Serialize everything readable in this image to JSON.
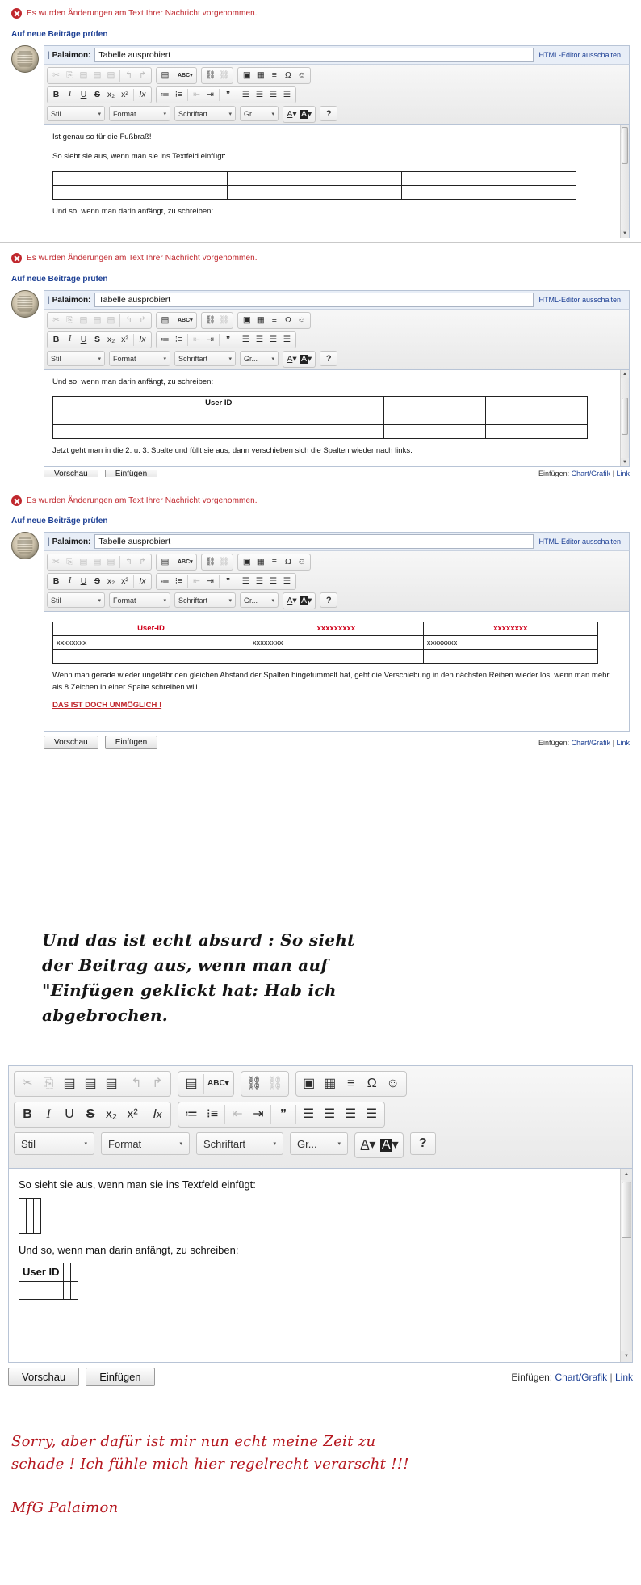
{
  "alert": {
    "text": "Es wurden Änderungen am Text Ihrer Nachricht vorgenommen.",
    "icon": "error-circle-icon",
    "color": "#c0272d"
  },
  "check_posts_link": "Auf neue Beiträge prüfen",
  "subject": {
    "author_prefix": "|",
    "author": "Palaimon:",
    "value": "Tabelle ausprobiert",
    "html_editor_toggle": "HTML-Editor ausschalten"
  },
  "toolbar": {
    "row1": [
      {
        "name": "cut-icon",
        "glyph": "✂",
        "dim": true
      },
      {
        "name": "copy-icon",
        "glyph": "⎘",
        "dim": true
      },
      {
        "name": "paste-icon",
        "glyph": "📋",
        "dim": true
      },
      {
        "name": "paste-as-text-icon",
        "glyph": "📋",
        "dim": true
      },
      {
        "name": "paste-from-word-icon",
        "glyph": "📋",
        "dim": true
      },
      {
        "name": "undo-icon",
        "glyph": "↰",
        "dim": true
      },
      {
        "name": "redo-icon",
        "glyph": "↱",
        "dim": true
      }
    ],
    "row1b": [
      {
        "name": "blockquote-format-icon",
        "glyph": "▤"
      },
      {
        "name": "spellcheck-icon",
        "glyph": "ABC"
      }
    ],
    "row1c": [
      {
        "name": "link-icon",
        "glyph": "🔗"
      },
      {
        "name": "unlink-icon",
        "glyph": "🔗",
        "dim": true
      }
    ],
    "row1d": [
      {
        "name": "image-icon",
        "glyph": "🖼"
      },
      {
        "name": "table-icon",
        "glyph": "▦"
      },
      {
        "name": "horizontal-rule-icon",
        "glyph": "≡"
      },
      {
        "name": "special-character-icon",
        "glyph": "Ω"
      },
      {
        "name": "smiley-icon",
        "glyph": "☺"
      }
    ],
    "row2": [
      {
        "name": "bold-icon",
        "glyph": "B"
      },
      {
        "name": "italic-icon",
        "glyph": "I"
      },
      {
        "name": "underline-icon",
        "glyph": "U"
      },
      {
        "name": "strikethrough-icon",
        "glyph": "S"
      },
      {
        "name": "subscript-icon",
        "glyph": "x₂"
      },
      {
        "name": "superscript-icon",
        "glyph": "x²"
      },
      {
        "name": "remove-format-icon",
        "glyph": "Ix"
      }
    ],
    "row2b": [
      {
        "name": "numbered-list-icon",
        "glyph": "⒈≡"
      },
      {
        "name": "bulleted-list-icon",
        "glyph": "⁞≡"
      },
      {
        "name": "outdent-icon",
        "glyph": "⇤",
        "dim": true
      },
      {
        "name": "indent-icon",
        "glyph": "⇥"
      },
      {
        "name": "blockquote-icon",
        "glyph": "❞"
      },
      {
        "name": "align-left-icon",
        "glyph": "☰"
      },
      {
        "name": "align-center-icon",
        "glyph": "☰"
      },
      {
        "name": "align-right-icon",
        "glyph": "☰"
      },
      {
        "name": "align-justify-icon",
        "glyph": "☰"
      }
    ],
    "selects": [
      {
        "name": "style-select",
        "label": "Stil"
      },
      {
        "name": "format-select",
        "label": "Format"
      },
      {
        "name": "font-select",
        "label": "Schriftart"
      },
      {
        "name": "size-select",
        "label": "Gr..."
      }
    ],
    "color_buttons": [
      {
        "name": "text-color-button",
        "glyph": "A"
      },
      {
        "name": "background-color-button",
        "glyph": "A"
      }
    ],
    "help_button": "?"
  },
  "footer": {
    "preview_label": "Vorschau",
    "insert_label": "Einfügen",
    "insert_prefix": "Einfügen:",
    "chart_link": "Chart/Grafik",
    "separator": "|",
    "link_link": "Link"
  },
  "snippet1": {
    "line1": "Ist genau so für die Fußbraß!",
    "line2": "So sieht sie aus, wenn man sie ins Textfeld einfügt:",
    "line3": "Und so, wenn man darin anfängt, zu schreiben:"
  },
  "snippet2": {
    "line1": "Und so, wenn man darin anfängt, zu schreiben:",
    "table_header": "User ID",
    "line2": "Jetzt geht man in die 2. u. 3. Spalte und füllt sie aus, dann verschieben sich die Spalten wieder nach links."
  },
  "snippet3": {
    "table": {
      "headers": [
        "User-ID",
        "xxxxxxxxx",
        "xxxxxxxx"
      ],
      "rows": [
        [
          "xxxxxxxx",
          "xxxxxxxx",
          "xxxxxxxx"
        ],
        [
          "",
          "",
          ""
        ]
      ]
    },
    "paragraph": "Wenn man gerade wieder ungefähr den gleichen Abstand der Spalten hingefummelt hat, geht die Verschiebung in den nächsten Reihen wieder los, wenn man mehr als 8 Zeichen in einer Spalte schreiben will.",
    "shout": "DAS IST DOCH UNMÖGLICH !"
  },
  "handwriting1": [
    "Und das ist echt absurd : So sieht",
    "der Beitrag aus, wenn man auf",
    "\"Einfügen geklickt hat: Hab ich",
    "abgebrochen."
  ],
  "snippet4": {
    "line1": "So sieht sie aus, wenn man sie ins Textfeld einfügt:",
    "line2": "Und so, wenn man darin anfängt, zu schreiben:",
    "table_header": "User ID"
  },
  "handwriting2": [
    "Sorry, aber dafür ist mir nun echt meine Zeit zu",
    "schade ! Ich fühle mich hier regelrecht verarscht !!!",
    "",
    "MfG Palaimon"
  ],
  "colors": {
    "alert_red": "#c0272d",
    "link_blue": "#1c3f94",
    "table_red": "#d0021b",
    "hand_red": "#b5171f"
  }
}
